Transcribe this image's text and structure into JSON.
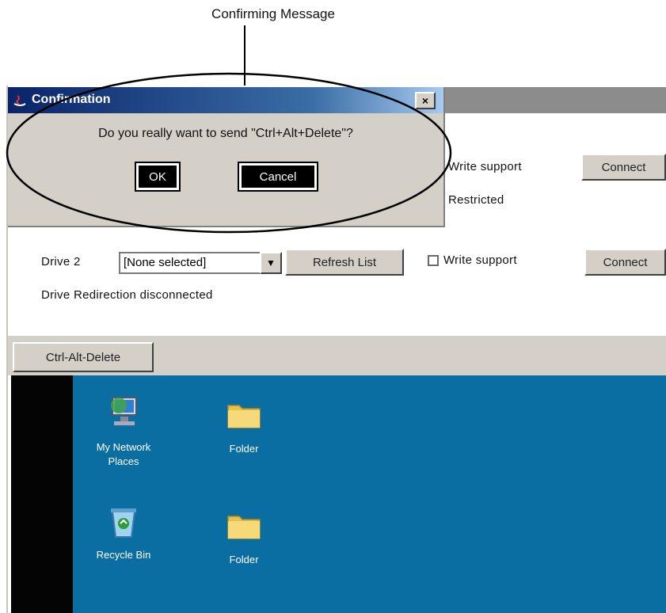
{
  "callout": {
    "label": "Confirming Message"
  },
  "dialog": {
    "title": "Confirmation",
    "close_symbol": "×",
    "message": "Do you really want to send \"Ctrl+Alt+Delete\"?",
    "ok_label": "OK",
    "cancel_label": "Cancel"
  },
  "upper_row": {
    "write_support_label": "Write support",
    "connect_label": "Connect",
    "status_text": "Restricted"
  },
  "drive_row": {
    "label": "Drive 2",
    "selected_drive": "[None selected]",
    "refresh_label": "Refresh List",
    "write_support_label": "Write support",
    "connect_label": "Connect",
    "status_text": "Drive Redirection disconnected"
  },
  "ctrl_alt_del_label": "Ctrl-Alt-Delete",
  "desktop": {
    "icons": [
      {
        "name": "network-places-icon",
        "label_line1": "My Network",
        "label_line2": "Places"
      },
      {
        "name": "folder-icon",
        "label_line1": "Folder",
        "label_line2": ""
      },
      {
        "name": "recycle-bin-icon",
        "label_line1": "Recycle Bin",
        "label_line2": ""
      },
      {
        "name": "folder-icon",
        "label_line1": "Folder",
        "label_line2": ""
      }
    ]
  },
  "colors": {
    "desktop_blue": "#0a6ea3",
    "dialog_face": "#d4d0c8",
    "title_gradient_start": "#0a246a"
  }
}
